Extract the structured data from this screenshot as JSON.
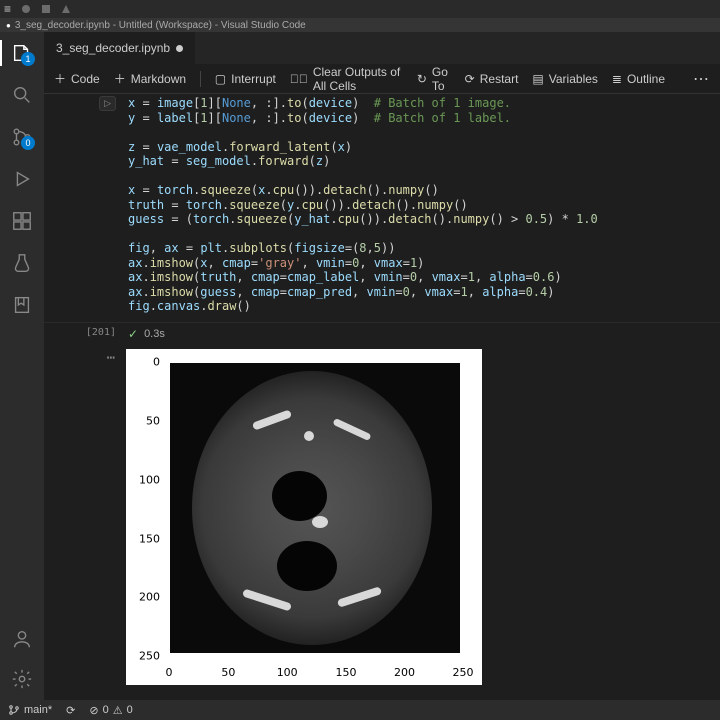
{
  "window": {
    "title": "3_seg_decoder.ipynb - Untitled (Workspace) - Visual Studio Code"
  },
  "tab": {
    "filename": "3_seg_decoder.ipynb"
  },
  "toolbar": {
    "code": "Code",
    "markdown": "Markdown",
    "interrupt": "Interrupt",
    "clear_outputs": "Clear Outputs of All Cells",
    "goto": "Go To",
    "restart": "Restart",
    "variables": "Variables",
    "outline": "Outline"
  },
  "activity": {
    "explorer_badge": "1",
    "scm_badge": "0"
  },
  "chart_data": {
    "type": "image",
    "title": "",
    "xlabel": "",
    "ylabel": "",
    "xlim": [
      0,
      256
    ],
    "ylim": [
      256,
      0
    ],
    "x_ticks": [
      0,
      50,
      100,
      150,
      200,
      250
    ],
    "y_ticks": [
      0,
      50,
      100,
      150,
      200,
      250
    ],
    "description": "Grayscale CT axial slice (torso cross-section), dark background, body oval in mid-gray with two dark lung-like cavities and scattered bright bone structures",
    "figsize": [
      8,
      5
    ],
    "overlays": [
      {
        "name": "truth",
        "cmap": "cmap_label",
        "vmin": 0,
        "vmax": 1,
        "alpha": 0.6
      },
      {
        "name": "guess",
        "cmap": "cmap_pred",
        "vmin": 0,
        "vmax": 1,
        "alpha": 0.4
      }
    ]
  },
  "cell": {
    "exec_count": "[201]",
    "run_time": "0.3s"
  },
  "status": {
    "branch": "main*",
    "errors": "0",
    "warnings": "0"
  }
}
